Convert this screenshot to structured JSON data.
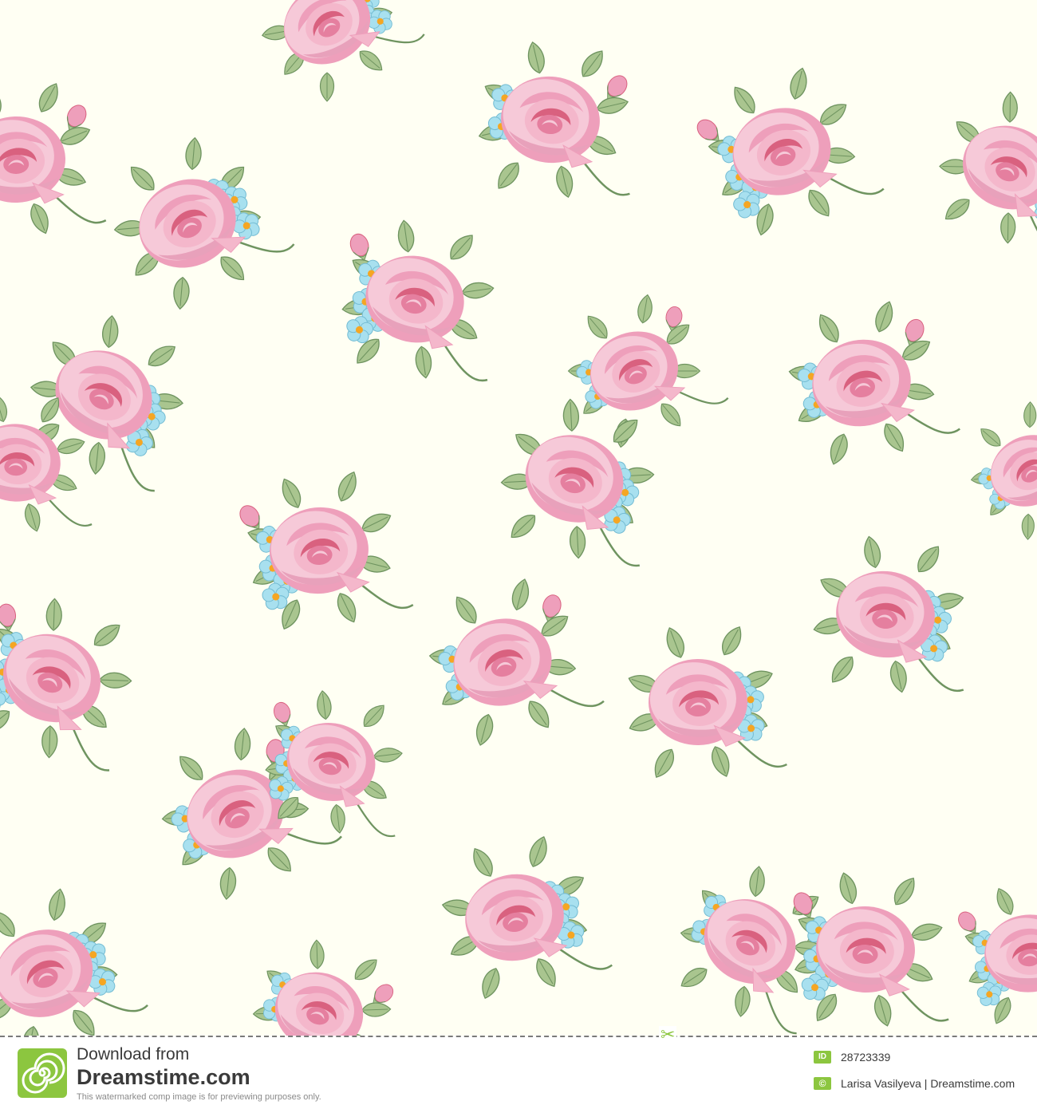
{
  "pattern": {
    "description_icon": "rose-bouquet",
    "colors": {
      "background": "#fffff3",
      "rose_light": "#f6c9d8",
      "rose_mid": "#ee9fbb",
      "rose_dark": "#d9617f",
      "leaf": "#a9c58f",
      "leaf_dark": "#6f9460",
      "forget_me_not": "#a8e0ef",
      "flower_center": "#f5a623"
    }
  },
  "watermark": {
    "download_label": "Download from",
    "brand": "Dreamstime.com",
    "notice": "This watermarked comp image is for previewing purposes only.",
    "id_badge": "ID",
    "id_value": "28723339",
    "copyright_badge": "©",
    "credit": "Larisa Vasilyeva | Dreamstime.com",
    "accent": "#8cc63f"
  }
}
